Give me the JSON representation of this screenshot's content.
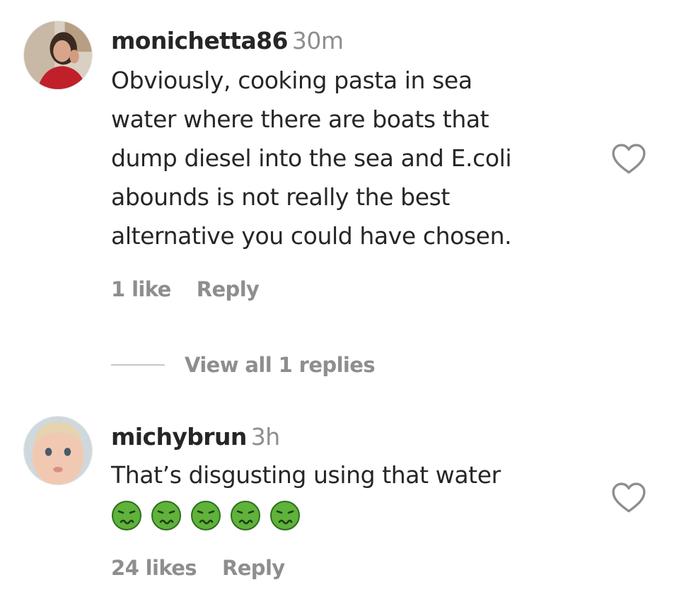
{
  "comments": [
    {
      "username": "monichetta86",
      "time": "30m",
      "lines": [
        "Obviously, cooking pasta in sea",
        "water where there are boats that",
        "dump diesel into the sea and E.coli",
        "abounds is not really the best",
        "alternative you could have chosen."
      ],
      "likes": "1 like",
      "reply_label": "Reply",
      "view_replies": "View all 1 replies",
      "avatar_icon": "profile-photo-woman-icon"
    },
    {
      "username": "michybrun",
      "time": "3h",
      "lines": [
        "That’s disgusting using that water"
      ],
      "emoji": [
        "nauseated-face",
        "nauseated-face",
        "nauseated-face",
        "nauseated-face",
        "nauseated-face"
      ],
      "likes": "24 likes",
      "reply_label": "Reply",
      "avatar_icon": "profile-photo-baby-icon"
    }
  ],
  "colors": {
    "text": "#262626",
    "secondary": "#8e8e8e",
    "emoji_green": "#5fb23a"
  }
}
